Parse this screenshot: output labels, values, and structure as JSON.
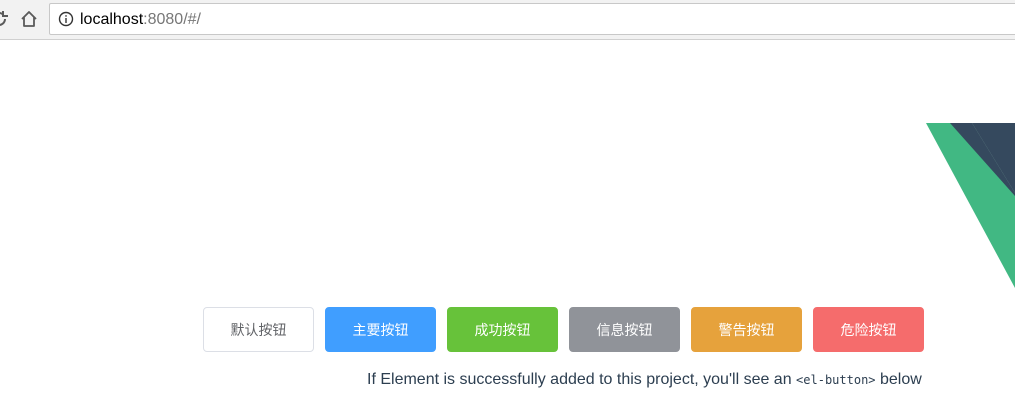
{
  "browser": {
    "url_host": "localhost",
    "url_rest": ":8080/#/",
    "icons": {
      "reload": "reload-icon",
      "home": "home-icon",
      "info": "info-icon"
    }
  },
  "buttons": [
    {
      "label": "默认按钮",
      "type": "default"
    },
    {
      "label": "主要按钮",
      "type": "primary"
    },
    {
      "label": "成功按钮",
      "type": "success"
    },
    {
      "label": "信息按钮",
      "type": "info"
    },
    {
      "label": "警告按钮",
      "type": "warning"
    },
    {
      "label": "危险按钮",
      "type": "danger"
    }
  ],
  "message": {
    "before": "If Element is successfully added to this project, you'll see an ",
    "code": "<el-button>",
    "after": " below"
  },
  "colors": {
    "vue_green": "#41b883",
    "vue_dark": "#35495e",
    "primary": "#409eff",
    "success": "#67c23a",
    "info": "#909399",
    "warning": "#e6a23c",
    "danger": "#f56c6c"
  }
}
